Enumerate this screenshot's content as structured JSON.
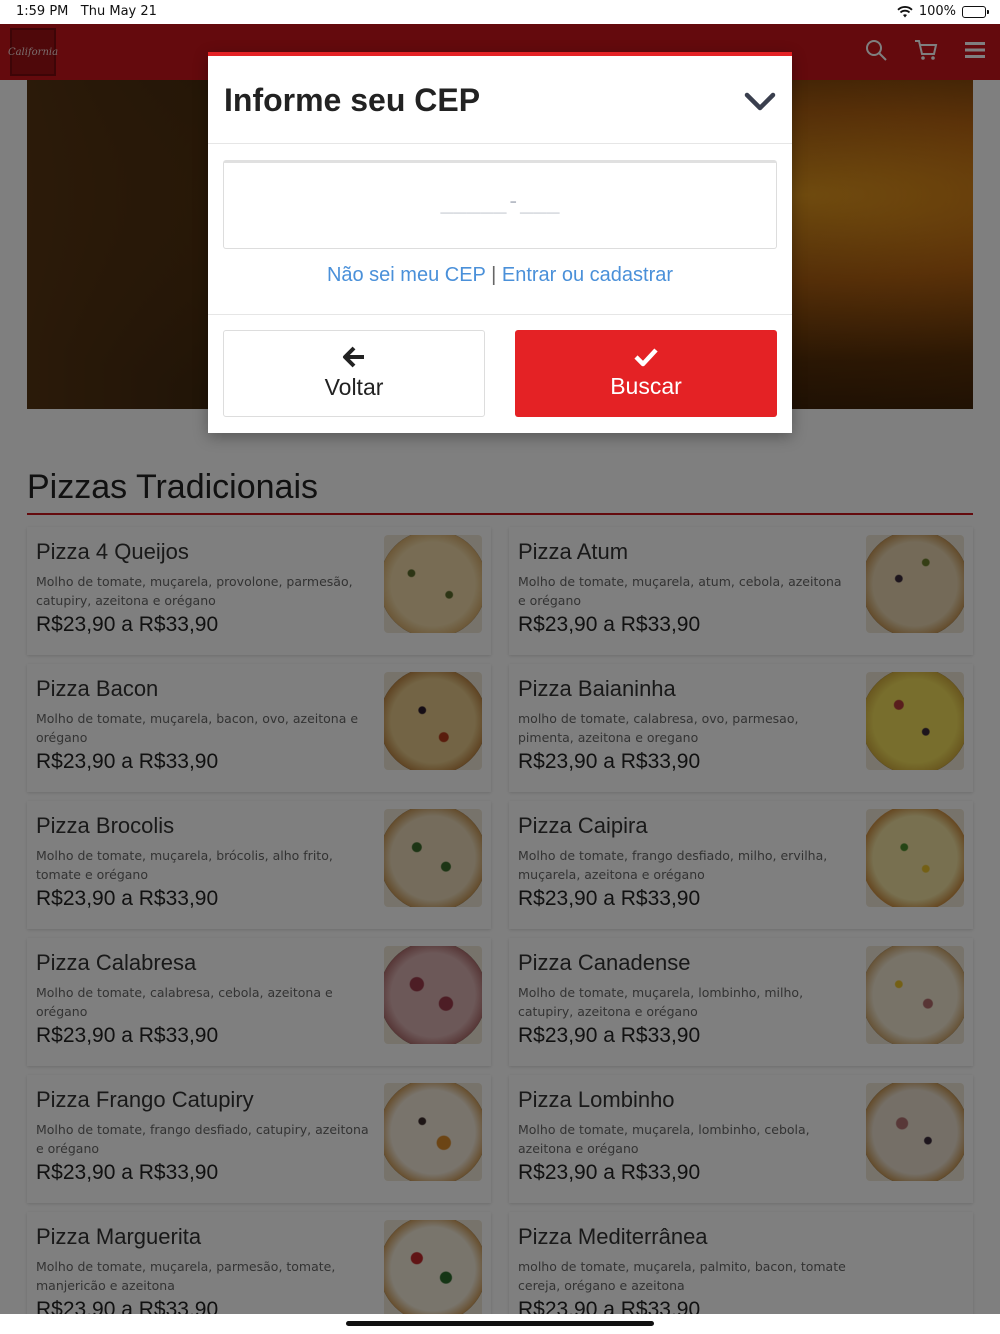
{
  "status_bar": {
    "time": "1:59 PM",
    "date": "Thu May 21",
    "battery": "100%"
  },
  "header": {
    "logo_text": "California",
    "icons": [
      "search-icon",
      "cart-icon",
      "menu-icon"
    ],
    "color": "#c8151b"
  },
  "modal": {
    "title": "Informe seu CEP",
    "cep_placeholder": "_____-___",
    "link_dont_know": "Não sei meu CEP",
    "link_separator": "|",
    "link_login": "Entrar ou cadastrar",
    "back_label": "Voltar",
    "search_label": "Buscar",
    "accent": "#e42225",
    "link_color": "#4a90d9"
  },
  "menu": {
    "section_title": "Pizzas Tradicionais",
    "items": [
      {
        "name": "Pizza 4 Queijos",
        "desc": "Molho de tomate, muçarela, provolone, parmesão, catupiry, azeitona e orégano",
        "price": "R$23,90 a R$33,90"
      },
      {
        "name": "Pizza Atum",
        "desc": "Molho de tomate, muçarela, atum, cebola, azeitona e orégano",
        "price": "R$23,90 a R$33,90"
      },
      {
        "name": "Pizza Bacon",
        "desc": "Molho de tomate, muçarela, bacon, ovo, azeitona e orégano",
        "price": "R$23,90 a R$33,90"
      },
      {
        "name": "Pizza Baianinha",
        "desc": "molho de tomate, calabresa, ovo, parmesao, pimenta, azeitona e oregano",
        "price": "R$23,90 a R$33,90"
      },
      {
        "name": "Pizza Brocolis",
        "desc": "Molho de tomate, muçarela, brócolis, alho frito, tomate e orégano",
        "price": "R$23,90 a R$33,90"
      },
      {
        "name": "Pizza Caipira",
        "desc": "Molho de tomate, frango desfiado, milho, ervilha, muçarela, azeitona e orégano",
        "price": "R$23,90 a R$33,90"
      },
      {
        "name": "Pizza Calabresa",
        "desc": "Molho de tomate, calabresa, cebola, azeitona e orégano",
        "price": "R$23,90 a R$33,90"
      },
      {
        "name": "Pizza Canadense",
        "desc": "Molho de tomate, muçarela, lombinho, milho, catupiry, azeitona e orégano",
        "price": "R$23,90 a R$33,90"
      },
      {
        "name": "Pizza Frango Catupiry",
        "desc": "Molho de tomate, frango desfiado, catupiry, azeitona e orégano",
        "price": "R$23,90 a R$33,90"
      },
      {
        "name": "Pizza Lombinho",
        "desc": "Molho de tomate, muçarela, lombinho, cebola, azeitona e orégano",
        "price": "R$23,90 a R$33,90"
      },
      {
        "name": "Pizza Marguerita",
        "desc": "Molho de tomate, muçarela, parmesão, tomate, manjericão e azeitona",
        "price": "R$23,90 a R$33,90"
      },
      {
        "name": "Pizza Mediterrânea",
        "desc": "molho de tomate, muçarela, palmito, bacon, tomate cereja, orégano e azeitona",
        "price": "R$23,90 a R$33,90"
      }
    ]
  }
}
